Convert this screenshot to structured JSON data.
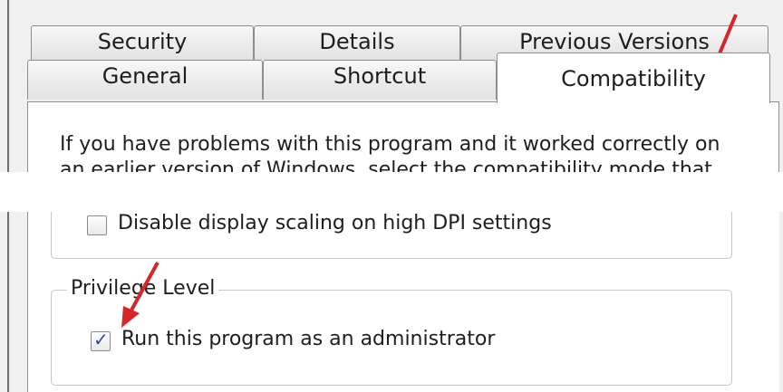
{
  "tabs_row1": [
    "Security",
    "Details",
    "Previous Versions"
  ],
  "tabs_row2": [
    "General",
    "Shortcut",
    "Compatibility"
  ],
  "active_tab": "Compatibility",
  "description": "If you have problems with this program and it worked correctly on an earlier version of Windows, select the compatibility mode that",
  "settings": {
    "dpi_label": "Disable display scaling on high DPI settings",
    "dpi_checked": false
  },
  "privilege": {
    "legend": "Privilege Level",
    "admin_label": "Run this program as an administrator",
    "admin_checked": true
  },
  "colors": {
    "arrow": "#d7262a"
  }
}
